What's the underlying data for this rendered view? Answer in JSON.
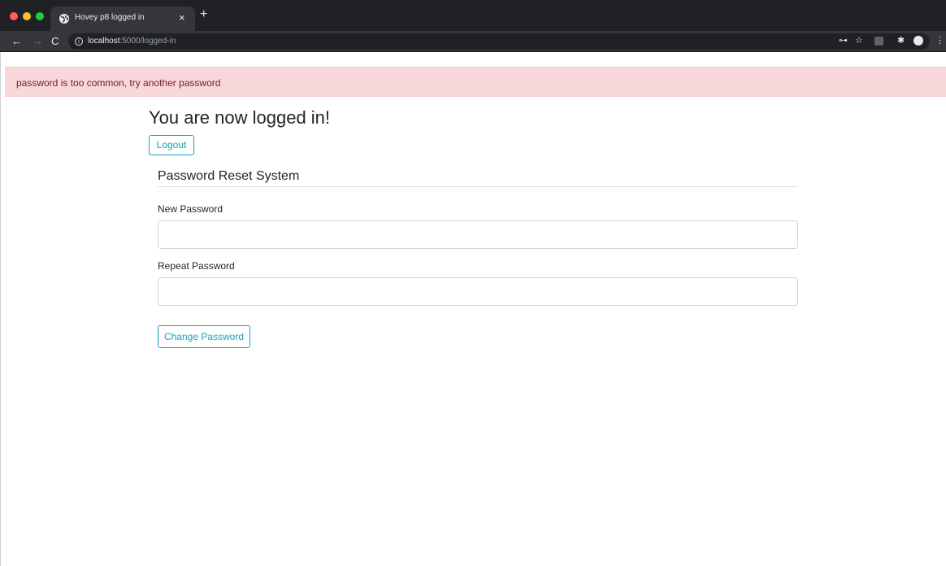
{
  "browser": {
    "tab_title": "Hovey p8 logged in",
    "tab_close": "×",
    "new_tab": "+",
    "nav": {
      "back": "←",
      "forward": "→",
      "reload": "C"
    },
    "url_host": "localhost",
    "url_rest": ":5000/logged-in",
    "icons": {
      "info": "i",
      "key": "⊶",
      "star": "☆",
      "extension": "✱",
      "menu": "⋮"
    }
  },
  "alert": {
    "message": "password is too common, try another password",
    "color": "#f8d7da"
  },
  "page": {
    "heading": "You are now logged in!",
    "logout_label": "Logout",
    "section_title": "Password Reset System",
    "new_password_label": "New Password",
    "new_password_value": "",
    "repeat_password_label": "Repeat Password",
    "repeat_password_value": "",
    "change_password_label": "Change Password",
    "accent_color": "#17a2b8"
  }
}
